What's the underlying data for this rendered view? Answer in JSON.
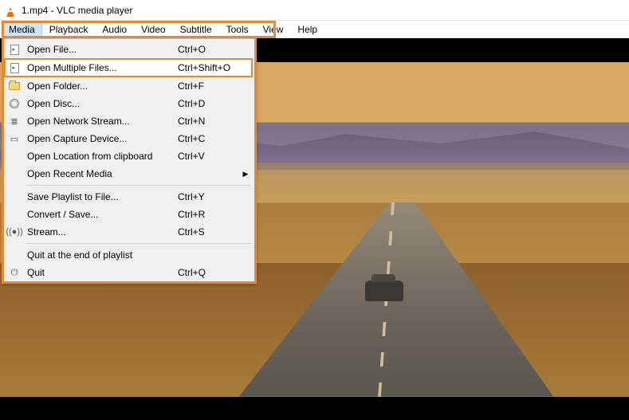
{
  "titlebar": {
    "title": "1.mp4 - VLC media player"
  },
  "menubar": {
    "items": [
      "Media",
      "Playback",
      "Audio",
      "Video",
      "Subtitle",
      "Tools",
      "View",
      "Help"
    ],
    "open_index": 0
  },
  "dropdown": {
    "groups": [
      [
        {
          "icon": "file-play-icon",
          "label": "Open File...",
          "shortcut": "Ctrl+O"
        },
        {
          "icon": "file-play-icon",
          "label": "Open Multiple Files...",
          "shortcut": "Ctrl+Shift+O",
          "highlight": true
        },
        {
          "icon": "folder-icon",
          "label": "Open Folder...",
          "shortcut": "Ctrl+F"
        },
        {
          "icon": "disc-icon",
          "label": "Open Disc...",
          "shortcut": "Ctrl+D"
        },
        {
          "icon": "network-icon",
          "label": "Open Network Stream...",
          "shortcut": "Ctrl+N"
        },
        {
          "icon": "capture-icon",
          "label": "Open Capture Device...",
          "shortcut": "Ctrl+C"
        },
        {
          "icon": "",
          "label": "Open Location from clipboard",
          "shortcut": "Ctrl+V"
        },
        {
          "icon": "",
          "label": "Open Recent Media",
          "shortcut": "",
          "submenu": true
        }
      ],
      [
        {
          "icon": "",
          "label": "Save Playlist to File...",
          "shortcut": "Ctrl+Y"
        },
        {
          "icon": "",
          "label": "Convert / Save...",
          "shortcut": "Ctrl+R"
        },
        {
          "icon": "stream-icon",
          "label": "Stream...",
          "shortcut": "Ctrl+S"
        }
      ],
      [
        {
          "icon": "",
          "label": "Quit at the end of playlist",
          "shortcut": ""
        },
        {
          "icon": "quit-icon",
          "label": "Quit",
          "shortcut": "Ctrl+Q"
        }
      ]
    ]
  }
}
